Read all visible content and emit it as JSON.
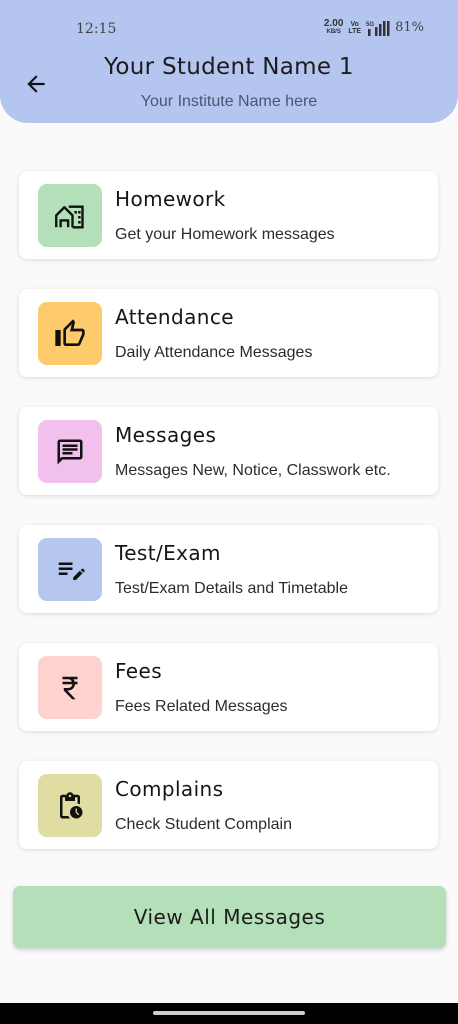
{
  "status_bar": {
    "time": "12:15",
    "net_speed_value": "2.00",
    "net_speed_unit": "KB/S",
    "volte_top": "Vo",
    "volte_bottom": "LTE",
    "network_label": "5G",
    "battery": "81%"
  },
  "header": {
    "title": "Your Student Name 1",
    "subtitle": "Your Institute Name here",
    "back_icon": "arrow-back-icon",
    "background": "#b4c5ef"
  },
  "menu": {
    "items": [
      {
        "title": "Homework",
        "description": "Get your Homework messages",
        "icon": "home-work-icon",
        "color": "#b4e0b9"
      },
      {
        "title": "Attendance",
        "description": "Daily Attendance Messages",
        "icon": "thumb-up-icon",
        "color": "#fdcb6b"
      },
      {
        "title": "Messages",
        "description": "Messages New, Notice, Classwork etc.",
        "icon": "chat-icon",
        "color": "#f2c0ec"
      },
      {
        "title": "Test/Exam",
        "description": "Test/Exam Details and Timetable",
        "icon": "edit-notes-icon",
        "color": "#b5c6ef"
      },
      {
        "title": "Fees",
        "description": "Fees Related Messages",
        "icon": "rupee-icon",
        "color": "#fdd2cf"
      },
      {
        "title": "Complains",
        "description": "Check Student Complain",
        "icon": "clipboard-clock-icon",
        "color": "#dfdda2"
      }
    ]
  },
  "footer": {
    "view_all_label": "View All Messages",
    "button_color": "#b3e0b8"
  }
}
